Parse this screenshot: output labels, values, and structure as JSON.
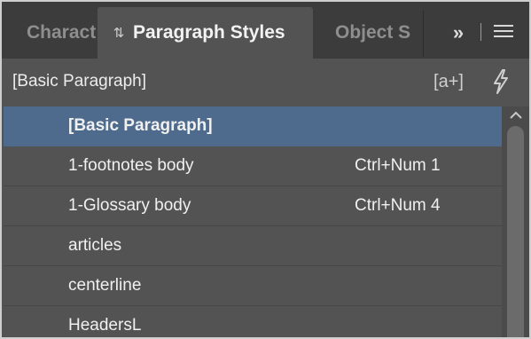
{
  "tabs": [
    {
      "label": "Charact",
      "active": false
    },
    {
      "label": "Paragraph Styles",
      "active": true,
      "icon": "chevron-updown-icon"
    },
    {
      "label": "Object S",
      "active": false
    }
  ],
  "toolbar": {
    "overflow_label": "»",
    "overflow_icon": "double-chevron-right-icon",
    "menu_icon": "hamburger-menu-icon"
  },
  "header": {
    "current_style": "[Basic Paragraph]",
    "new_style_label": "[a+]",
    "new_style_icon": "new-style-icon",
    "quick_apply_icon": "lightning-icon"
  },
  "styles": [
    {
      "name": "[Basic Paragraph]",
      "shortcut": "",
      "selected": true
    },
    {
      "name": "1-footnotes body",
      "shortcut": "Ctrl+Num 1",
      "selected": false
    },
    {
      "name": "1-Glossary body",
      "shortcut": "Ctrl+Num 4",
      "selected": false
    },
    {
      "name": "articles",
      "shortcut": "",
      "selected": false
    },
    {
      "name": "centerline",
      "shortcut": "",
      "selected": false
    },
    {
      "name": "HeadersL",
      "shortcut": "",
      "selected": false
    }
  ],
  "colors": {
    "panel_bg": "#535353",
    "tabbar_bg": "#3c3c3c",
    "selected_row": "#4e6a8d",
    "text": "#f0f0f0"
  }
}
